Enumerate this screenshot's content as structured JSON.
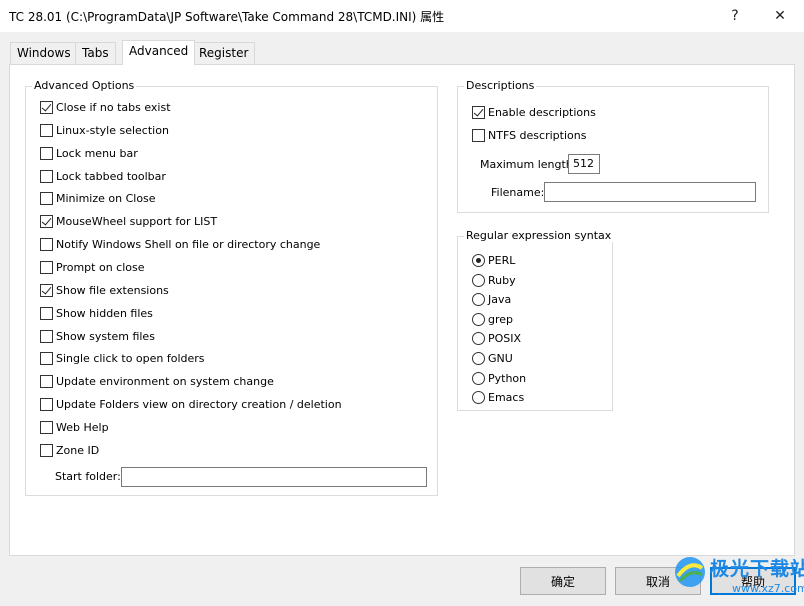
{
  "window": {
    "title": "TC 28.01  (C:\\ProgramData\\JP Software\\Take Command 28\\TCMD.INI)  属性",
    "help_glyph": "?",
    "close_glyph": "✕"
  },
  "tabs": [
    {
      "label": "Windows",
      "active": false
    },
    {
      "label": "Tabs",
      "active": false
    },
    {
      "label": "Advanced",
      "active": true
    },
    {
      "label": "Register",
      "active": false
    }
  ],
  "advanced_options": {
    "title": "Advanced Options",
    "items": [
      {
        "label": "Close if no tabs exist",
        "checked": true
      },
      {
        "label": "Linux-style selection",
        "checked": false
      },
      {
        "label": "Lock menu bar",
        "checked": false
      },
      {
        "label": "Lock tabbed toolbar",
        "checked": false
      },
      {
        "label": "Minimize on Close",
        "checked": false
      },
      {
        "label": "MouseWheel support for LIST",
        "checked": true
      },
      {
        "label": "Notify Windows Shell on file or directory change",
        "checked": false
      },
      {
        "label": "Prompt on close",
        "checked": false
      },
      {
        "label": "Show file extensions",
        "checked": true
      },
      {
        "label": "Show hidden files",
        "checked": false
      },
      {
        "label": "Show system files",
        "checked": false
      },
      {
        "label": "Single click to open folders",
        "checked": false
      },
      {
        "label": "Update environment on system change",
        "checked": false
      },
      {
        "label": "Update Folders view on directory creation / deletion",
        "checked": false
      },
      {
        "label": "Web Help",
        "checked": false
      },
      {
        "label": "Zone ID",
        "checked": false
      }
    ],
    "start_folder_label": "Start folder:",
    "start_folder_value": ""
  },
  "descriptions": {
    "title": "Descriptions",
    "enable_label": "Enable descriptions",
    "enable_checked": true,
    "ntfs_label": "NTFS descriptions",
    "ntfs_checked": false,
    "max_length_label": "Maximum length:",
    "max_length_value": "512",
    "filename_label": "Filename:",
    "filename_value": ""
  },
  "regex": {
    "title": "Regular expression syntax",
    "options": [
      {
        "label": "PERL",
        "selected": true
      },
      {
        "label": "Ruby",
        "selected": false
      },
      {
        "label": "Java",
        "selected": false
      },
      {
        "label": "grep",
        "selected": false
      },
      {
        "label": "POSIX",
        "selected": false
      },
      {
        "label": "GNU",
        "selected": false
      },
      {
        "label": "Python",
        "selected": false
      },
      {
        "label": "Emacs",
        "selected": false
      }
    ]
  },
  "buttons": {
    "ok": "确定",
    "cancel": "取消",
    "help": "帮助"
  },
  "watermark": {
    "text": "极光下载站",
    "url": "www.xz7.com"
  }
}
